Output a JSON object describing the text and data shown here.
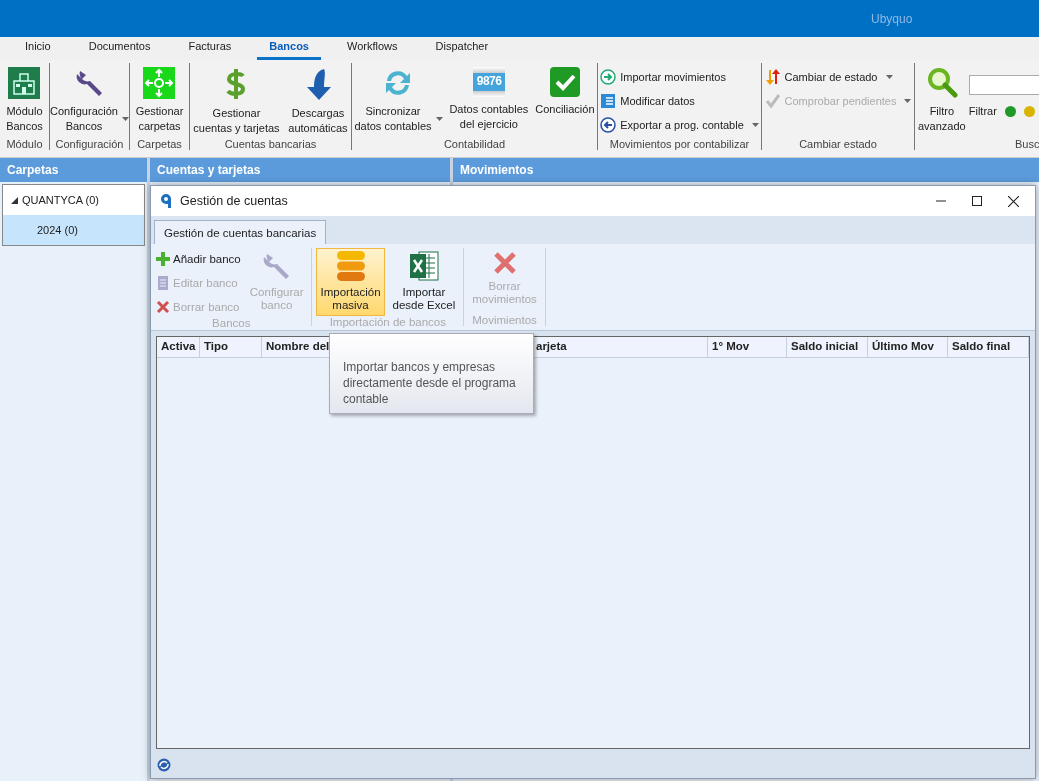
{
  "app": {
    "title": "Ubyquo"
  },
  "tabs": [
    {
      "label": "Inicio",
      "selected": false
    },
    {
      "label": "Documentos",
      "selected": false
    },
    {
      "label": "Facturas",
      "selected": false
    },
    {
      "label": "Bancos",
      "selected": true
    },
    {
      "label": "Workflows",
      "selected": false
    },
    {
      "label": "Dispatcher",
      "selected": false
    }
  ],
  "ribbon_groups": [
    {
      "label": "Módulo",
      "buttons": [
        {
          "kind": "large",
          "label": "Módulo\nBancos",
          "dropdown": false,
          "disabled": false
        }
      ]
    },
    {
      "label": "Configuración",
      "buttons": [
        {
          "kind": "large",
          "label": "Configuración\nBancos",
          "dropdown": true,
          "disabled": false
        }
      ]
    },
    {
      "label": "Carpetas",
      "buttons": [
        {
          "kind": "large",
          "label": "Gestionar\ncarpetas",
          "dropdown": false,
          "disabled": false
        }
      ]
    },
    {
      "label": "Cuentas bancarias",
      "buttons": [
        {
          "kind": "large",
          "label": "Gestionar\ncuentas y tarjetas",
          "dropdown": false,
          "disabled": false
        },
        {
          "kind": "large",
          "label": "Descargas\nautomáticas",
          "dropdown": false,
          "disabled": false
        }
      ]
    },
    {
      "label": "Contabilidad",
      "buttons": [
        {
          "kind": "large",
          "label": "Sincronizar\ndatos contables",
          "dropdown": true,
          "disabled": false
        },
        {
          "kind": "large",
          "label": "Datos contables\ndel ejercicio",
          "dropdown": false,
          "disabled": false,
          "icon_text": "9876"
        },
        {
          "kind": "large",
          "label": "Conciliación",
          "dropdown": false,
          "disabled": false
        }
      ]
    },
    {
      "label": "Movimientos por contabilizar",
      "buttons": [
        {
          "kind": "small",
          "label": "Importar movimientos",
          "dropdown": false,
          "disabled": false
        },
        {
          "kind": "small",
          "label": "Modificar datos",
          "dropdown": false,
          "disabled": false
        },
        {
          "kind": "small",
          "label": "Exportar a prog. contable",
          "dropdown": true,
          "disabled": false
        }
      ]
    },
    {
      "label": "Cambiar estado",
      "buttons": [
        {
          "kind": "small",
          "label": "Cambiar de estado",
          "dropdown": true,
          "disabled": false
        },
        {
          "kind": "small",
          "label": "Comprobar pendientes",
          "dropdown": true,
          "disabled": true
        }
      ]
    },
    {
      "label": "Busc",
      "buttons": [
        {
          "kind": "large",
          "label": "Filtro\navanzado",
          "dropdown": false,
          "disabled": false
        },
        {
          "kind": "search",
          "filter_label": "Filtrar",
          "filters": [
            {
              "color": "#1f9a2a"
            },
            {
              "color": "#d8b400"
            }
          ]
        }
      ]
    }
  ],
  "panels": [
    {
      "title": "Carpetas"
    },
    {
      "title": "Cuentas y tarjetas"
    },
    {
      "title": "Movimientos"
    }
  ],
  "tree": [
    {
      "label": "QUANTYCA (0)",
      "expanded": true,
      "selected": false,
      "children": [
        {
          "label": "2024 (0)",
          "selected": true
        }
      ]
    }
  ],
  "dialog": {
    "title": "Gestión de cuentas",
    "tabs": [
      {
        "label": "Gestión de cuentas bancarias",
        "selected": true
      }
    ],
    "groups": [
      {
        "label": "Bancos",
        "buttons": [
          {
            "kind": "small",
            "label": "Añadir banco",
            "disabled": false,
            "highlighted": false
          },
          {
            "kind": "small",
            "label": "Editar banco",
            "disabled": true,
            "highlighted": false
          },
          {
            "kind": "small",
            "label": "Borrar banco",
            "disabled": true,
            "highlighted": false
          },
          {
            "kind": "large",
            "label": "Configurar\nbanco",
            "disabled": true,
            "highlighted": false
          }
        ]
      },
      {
        "label": "Importación de bancos",
        "buttons": [
          {
            "kind": "large",
            "label": "Importación\nmasiva",
            "disabled": false,
            "highlighted": true
          },
          {
            "kind": "large",
            "label": "Importar\ndesde Excel",
            "disabled": false,
            "highlighted": false
          }
        ]
      },
      {
        "label": "Movimientos",
        "buttons": [
          {
            "kind": "large",
            "label": "Borrar\nmovimientos",
            "disabled": true,
            "highlighted": false
          }
        ]
      }
    ],
    "columns": [
      "Activa",
      "Tipo",
      "Nombre del",
      "arjeta",
      "1° Mov",
      "Saldo inicial",
      "Último Mov",
      "Saldo final"
    ],
    "tooltip": "Importar bancos y empresas directamente desde el programa contable"
  }
}
